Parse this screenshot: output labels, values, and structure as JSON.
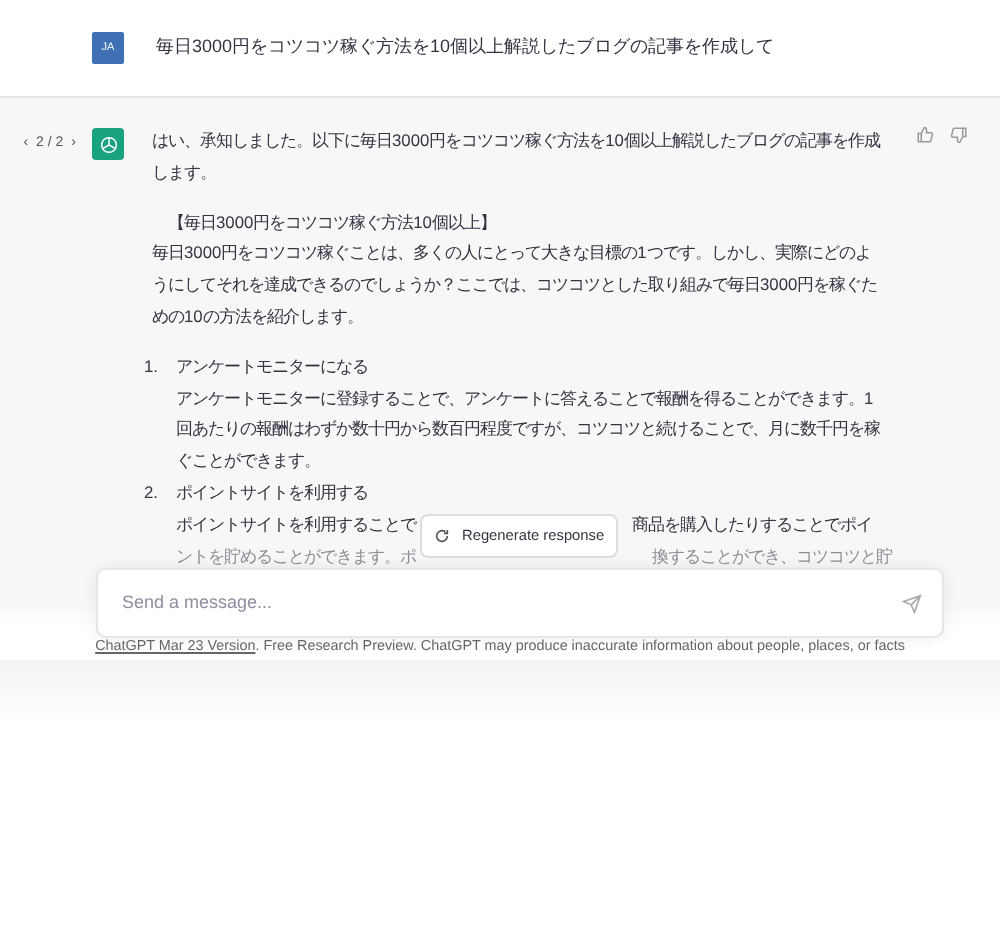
{
  "user_message": {
    "avatar": "JA",
    "text": "毎日3000円をコツコツ稼ぐ方法を10個以上解説したブログの記事を作成して"
  },
  "assistant_message": {
    "pager_prev": "‹",
    "pager": "2 / 2",
    "pager_next": "›",
    "intro": "はい、承知しました。以下に毎日3000円をコツコツ稼ぐ方法を10個以上解説したブログの記事を作成します。",
    "heading": "【毎日3000円をコツコツ稼ぐ方法10個以上】",
    "paragraph": "毎日3000円をコツコツ稼ぐことは、多くの人にとって大きな目標の1つです。しかし、実際にどのようにしてそれを達成できるのでしょうか？ここでは、コツコツとした取り組みで毎日3000円を稼ぐための10の方法を紹介します。",
    "list": [
      {
        "number": "1.",
        "title": "アンケートモニターになる",
        "kind": "plain",
        "description": "アンケートモニターに登録することで、アンケートに答えることで報酬を得ることができます。1回あたりの報酬はわずか数十円から数百円程度ですが、コツコツと続けることで、月に数千円を稼ぐことができます。"
      },
      {
        "number": "2.",
        "title": "ポイントサイトを利用する",
        "kind": "covered",
        "description_parts": [
          "ポイントサイトを利用することで",
          "商品を購入したりすることでポイ"
        ],
        "faded_parts": [
          "ントを貯めることができます。ポ",
          "換することができ、コツコツと貯"
        ]
      }
    ]
  },
  "regenerate_button": "Regenerate response",
  "composer": {
    "placeholder": "Send a message..."
  },
  "footer": {
    "link": "ChatGPT Mar 23 Version",
    "text": ". Free Research Preview. ChatGPT may produce inaccurate information about people, places, or facts"
  }
}
